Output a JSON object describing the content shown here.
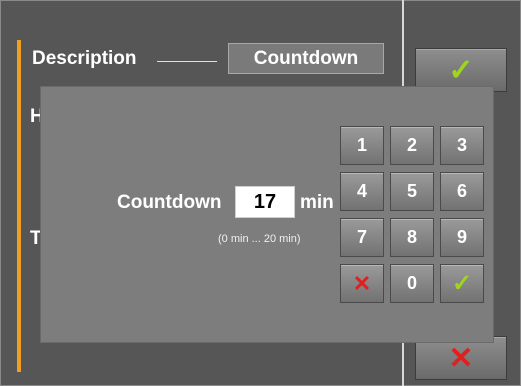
{
  "background": {
    "description_label": "Description",
    "description_value": "Countdown",
    "h_label": "H",
    "t_label": "T",
    "ok_icon": "✓",
    "cancel_icon": "✕"
  },
  "dialog": {
    "label": "Countdown",
    "value": "17",
    "unit": "min",
    "range": "(0 min ... 20 min)",
    "keys": [
      "1",
      "2",
      "3",
      "4",
      "5",
      "6",
      "7",
      "8",
      "9",
      "✕",
      "0",
      "✓"
    ]
  },
  "colors": {
    "accent": "#f0a020",
    "ok": "#9fd61a",
    "cancel": "#e02020"
  }
}
